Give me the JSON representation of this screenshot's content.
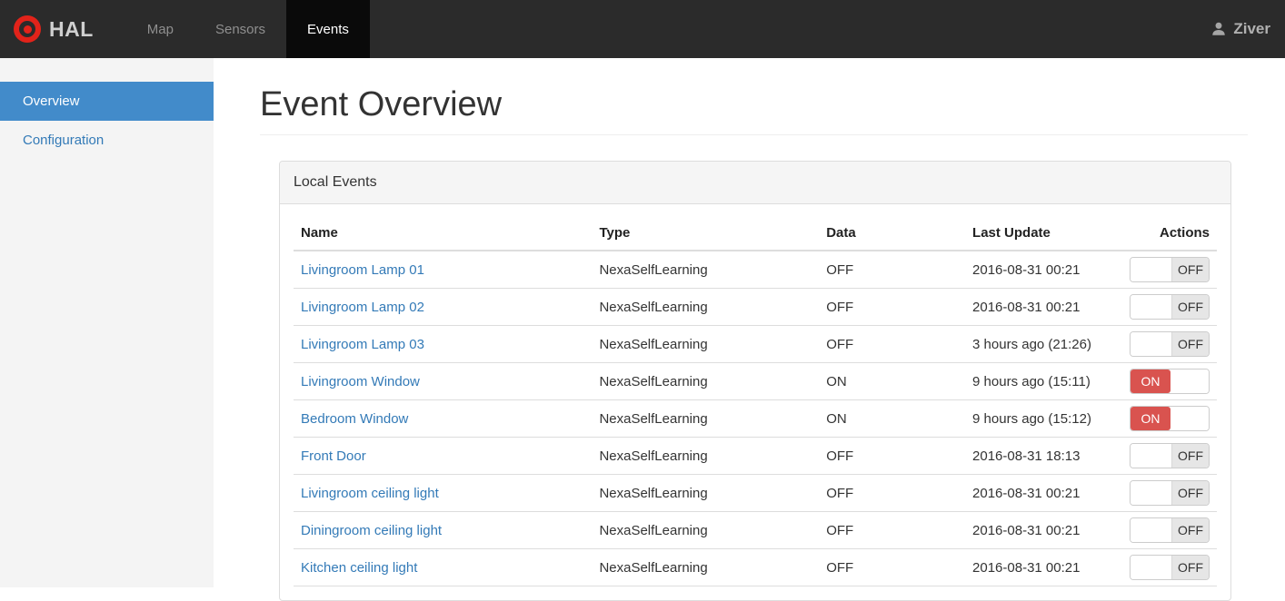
{
  "navbar": {
    "brand": "HAL",
    "items": [
      {
        "label": "Map",
        "active": false
      },
      {
        "label": "Sensors",
        "active": false
      },
      {
        "label": "Events",
        "active": true
      }
    ],
    "user": "Ziver"
  },
  "sidebar": {
    "items": [
      {
        "label": "Overview",
        "active": true
      },
      {
        "label": "Configuration",
        "active": false
      }
    ]
  },
  "page": {
    "title": "Event Overview"
  },
  "panel": {
    "title": "Local Events"
  },
  "table": {
    "headers": [
      "Name",
      "Type",
      "Data",
      "Last Update",
      "Actions"
    ],
    "rows": [
      {
        "name": "Livingroom Lamp 01",
        "type": "NexaSelfLearning",
        "data": "OFF",
        "last_update": "2016-08-31 00:21",
        "switch": "OFF"
      },
      {
        "name": "Livingroom Lamp 02",
        "type": "NexaSelfLearning",
        "data": "OFF",
        "last_update": "2016-08-31 00:21",
        "switch": "OFF"
      },
      {
        "name": "Livingroom Lamp 03",
        "type": "NexaSelfLearning",
        "data": "OFF",
        "last_update": "3 hours ago (21:26)",
        "switch": "OFF"
      },
      {
        "name": "Livingroom Window",
        "type": "NexaSelfLearning",
        "data": "ON",
        "last_update": "9 hours ago (15:11)",
        "switch": "ON"
      },
      {
        "name": "Bedroom Window",
        "type": "NexaSelfLearning",
        "data": "ON",
        "last_update": "9 hours ago (15:12)",
        "switch": "ON"
      },
      {
        "name": "Front Door",
        "type": "NexaSelfLearning",
        "data": "OFF",
        "last_update": "2016-08-31 18:13",
        "switch": "OFF"
      },
      {
        "name": "Livingroom ceiling light",
        "type": "NexaSelfLearning",
        "data": "OFF",
        "last_update": "2016-08-31 00:21",
        "switch": "OFF"
      },
      {
        "name": "Diningroom ceiling light",
        "type": "NexaSelfLearning",
        "data": "OFF",
        "last_update": "2016-08-31 00:21",
        "switch": "OFF"
      },
      {
        "name": "Kitchen ceiling light",
        "type": "NexaSelfLearning",
        "data": "OFF",
        "last_update": "2016-08-31 00:21",
        "switch": "OFF"
      }
    ]
  },
  "colors": {
    "navbar_bg": "#2b2b2b",
    "navbar_active_bg": "#0a0a0a",
    "sidebar_active": "#428bca",
    "link": "#337ab7",
    "toggle_on": "#d9534f",
    "logo_red": "#e2231a"
  }
}
